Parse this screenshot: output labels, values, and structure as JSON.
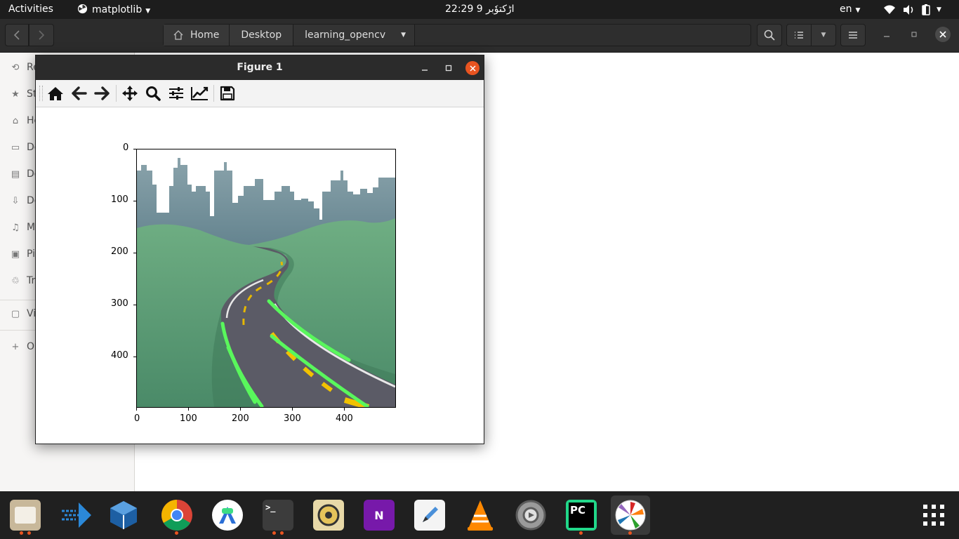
{
  "topbar": {
    "activities": "Activities",
    "app_menu": "matplotlib",
    "clock": "22:29  9 اڑکتوٗبر",
    "language": "en"
  },
  "files": {
    "crumbs": [
      "Home",
      "Desktop",
      "learning_opencv"
    ],
    "sidebar": [
      {
        "label": "Re",
        "icon": "recent-icon"
      },
      {
        "label": "St",
        "icon": "starred-icon"
      },
      {
        "label": "Ho",
        "icon": "home-icon"
      },
      {
        "label": "De",
        "icon": "desktop-icon"
      },
      {
        "label": "Do",
        "icon": "documents-icon"
      },
      {
        "label": "Do",
        "icon": "downloads-icon"
      },
      {
        "label": "M",
        "icon": "music-icon"
      },
      {
        "label": "Pi",
        "icon": "pictures-icon"
      },
      {
        "label": "Tr",
        "icon": "trash-icon"
      },
      {
        "label": "Vi",
        "icon": "folder-icon"
      },
      {
        "label": "O",
        "icon": "plus-icon"
      }
    ]
  },
  "figure": {
    "title": "Figure 1",
    "y_ticks": [
      "0",
      "100",
      "200",
      "300",
      "400"
    ],
    "x_ticks": [
      "0",
      "100",
      "200",
      "300",
      "400"
    ]
  },
  "dock": {
    "apps": [
      {
        "name": "files",
        "color": "#c8b89a",
        "running": true
      },
      {
        "name": "visual-studio-code",
        "color": "#2b88d8",
        "running": false
      },
      {
        "name": "virtualbox",
        "color": "#1d5fa3",
        "running": false
      },
      {
        "name": "google-chrome",
        "color": "#4285f4",
        "running": true
      },
      {
        "name": "android-studio",
        "color": "#3ddc84",
        "running": false
      },
      {
        "name": "terminal",
        "color": "#3c3c3c",
        "running": true
      },
      {
        "name": "rhythmbox",
        "color": "#e5c35a",
        "running": false
      },
      {
        "name": "onenote",
        "color": "#7719aa",
        "running": false
      },
      {
        "name": "text-editor",
        "color": "#4a90d9",
        "running": false
      },
      {
        "name": "vlc",
        "color": "#ff8800",
        "running": false
      },
      {
        "name": "settings",
        "color": "#9a9a9a",
        "running": false
      },
      {
        "name": "pycharm",
        "color": "#21d789",
        "running": true
      },
      {
        "name": "matplotlib",
        "color": "#ffffff",
        "running": true
      }
    ]
  }
}
